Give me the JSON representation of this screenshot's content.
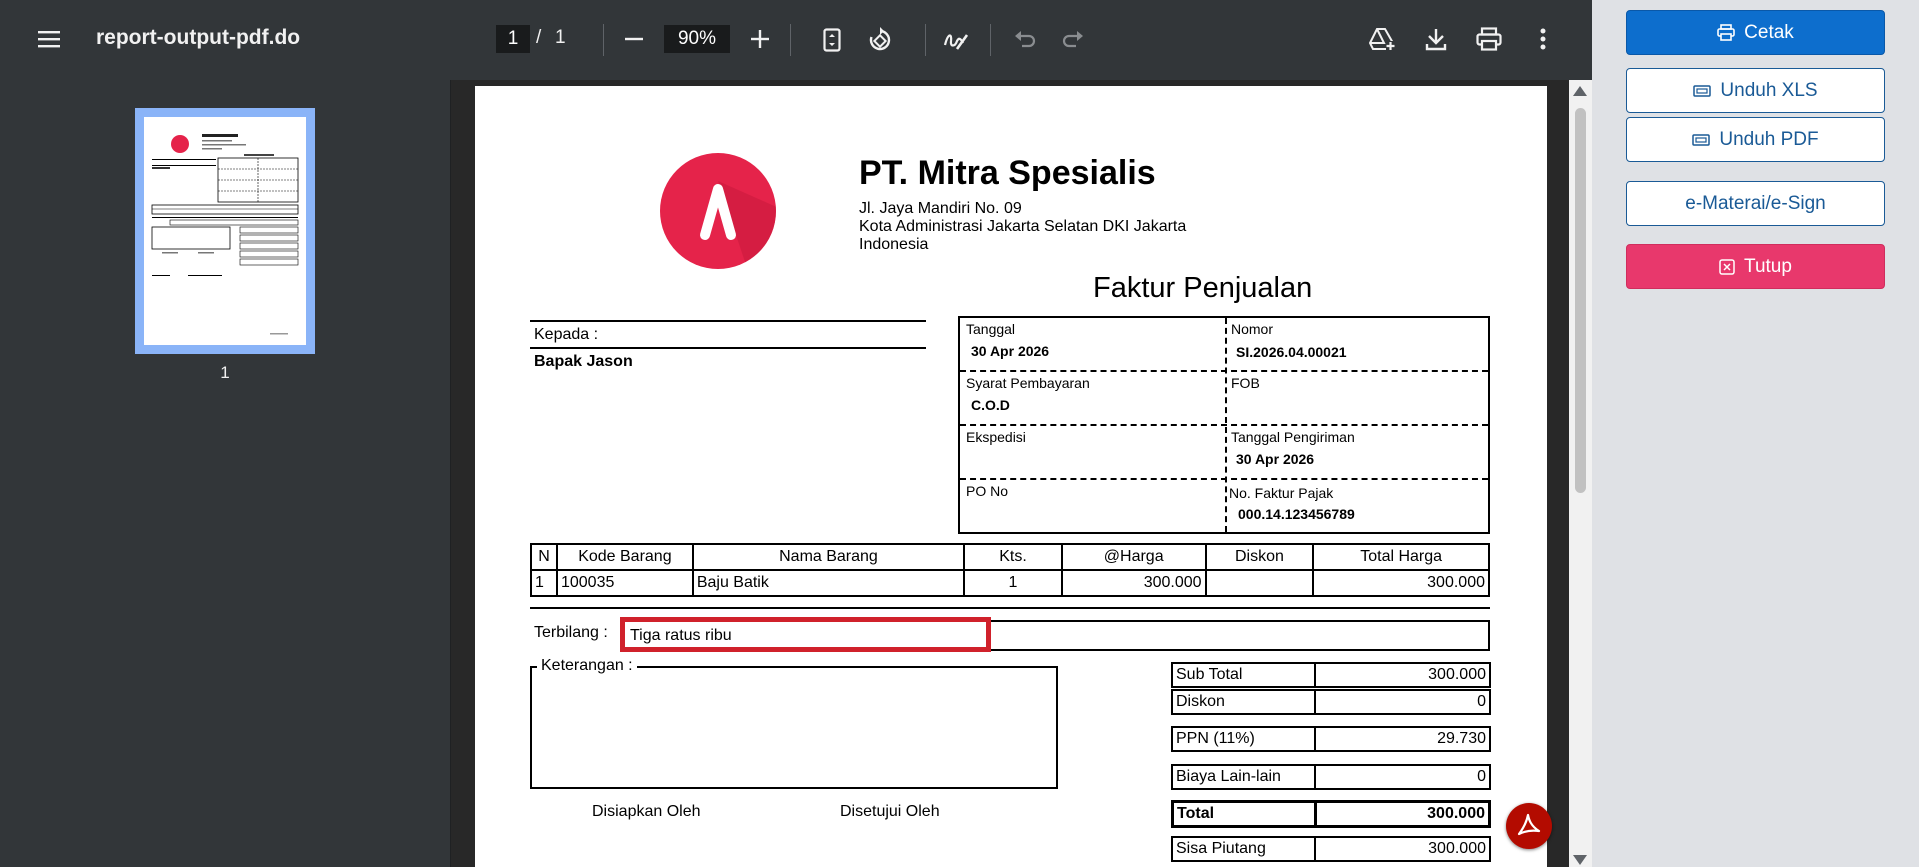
{
  "viewer": {
    "title": "report-output-pdf.do",
    "page_current": "1",
    "page_separator": "/",
    "page_total": "1",
    "zoom": "90%",
    "thumbnail_page_number": "1"
  },
  "document": {
    "company_name": "PT. Mitra Spesialis",
    "address_line1": "Jl. Jaya Mandiri No. 09",
    "address_line2": "Kota Administrasi Jakarta Selatan DKI Jakarta",
    "address_line3": "Indonesia",
    "title": "Faktur Penjualan",
    "kepada_label": "Kepada :",
    "customer": "Bapak Jason",
    "info": {
      "tanggal_label": "Tanggal",
      "tanggal_value": "30 Apr 2026",
      "nomor_label": "Nomor",
      "nomor_value": "SI.2026.04.00021",
      "syarat_label": "Syarat Pembayaran",
      "syarat_value": "C.O.D",
      "fob_label": "FOB",
      "fob_value": "",
      "ekspedisi_label": "Ekspedisi",
      "ekspedisi_value": "",
      "tgl_kirim_label": "Tanggal Pengiriman",
      "tgl_kirim_value": "30 Apr 2026",
      "po_label": "PO No",
      "po_value": "",
      "faktur_pajak_label": "No. Faktur Pajak",
      "faktur_pajak_value": "000.14.123456789"
    },
    "table": {
      "headers": [
        "N",
        "Kode Barang",
        "Nama Barang",
        "Kts.",
        "@Harga",
        "Diskon",
        "Total Harga"
      ],
      "rows": [
        [
          "1",
          "100035",
          "Baju Batik",
          "1",
          "300.000",
          "",
          "300.000"
        ]
      ]
    },
    "terbilang_label": "Terbilang :",
    "terbilang_value": "Tiga ratus ribu",
    "keterangan_label": "Keterangan :",
    "disiapkan_label": "Disiapkan Oleh",
    "disetujui_label": "Disetujui Oleh",
    "totals": {
      "sub_total_label": "Sub Total",
      "sub_total_value": "300.000",
      "diskon_label": "Diskon",
      "diskon_value": "0",
      "ppn_label": "PPN (11%)",
      "ppn_value": "29.730",
      "biaya_label": "Biaya Lain-lain",
      "biaya_value": "0",
      "total_label": "Total",
      "total_value": "300.000",
      "sisa_label": "Sisa Piutang",
      "sisa_value": "300.000"
    }
  },
  "panel": {
    "cetak": "Cetak",
    "unduh_xls": "Unduh XLS",
    "unduh_pdf": "Unduh PDF",
    "e_materai": "e-Materai/e-Sign",
    "tutup": "Tutup"
  },
  "colors": {
    "toolbar_bg": "#323639",
    "viewer_bg": "#282828",
    "logo_red": "#e5234a",
    "highlight_red": "#d0212b",
    "primary_blue": "#0d6ecd",
    "outline_blue": "#1a5a96",
    "danger_pink": "#e8386c",
    "panel_bg": "#dfe1e5"
  }
}
